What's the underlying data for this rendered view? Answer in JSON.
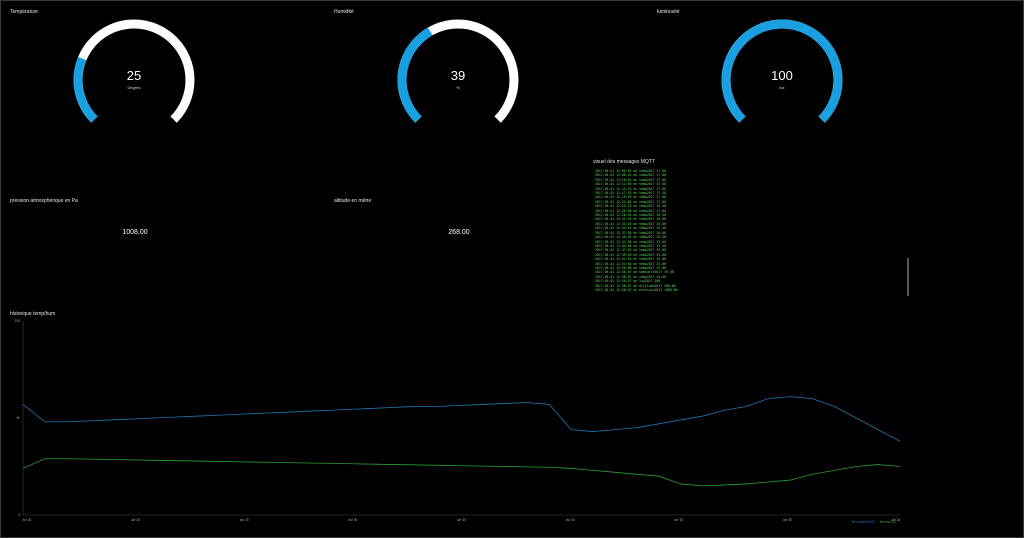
{
  "gauges": [
    {
      "title": "Température",
      "value": "25",
      "unit": "Degres",
      "fraction": 0.25,
      "color": "#1aa0e0"
    },
    {
      "title": "Humidité",
      "value": "39",
      "unit": "%",
      "fraction": 0.39,
      "color": "#1aa0e0"
    },
    {
      "title": "luminosité",
      "value": "100",
      "unit": "lux",
      "fraction": 1.0,
      "color": "#1aa0e0"
    }
  ],
  "pressure": {
    "title": "pression atmosphérique en Pa",
    "value": "1008.00"
  },
  "altitude": {
    "title": "altitude en mètre",
    "value": "268.00"
  },
  "mqtt": {
    "title": "visuel des messages MQTT",
    "messages": [
      "2017-05-01 12:05:53 on temp2017 27.00",
      "2017-05-01 12:08:22 on temp2017 27.00",
      "2017-05-01 12:10:41 on temp2017 27.00",
      "2017-05-01 12:12:55 on temp2017 27.00",
      "2017-05-01 12:15:13 on temp2017 27.00",
      "2017-05-01 12:17:31 on temp2017 27.50",
      "2017-05-01 12:19:49 on temp2017 27.00",
      "2017-05-01 12:22:06 on temp2017 27.00",
      "2017-05-01 12:24:22 on temp2017 26.50",
      "2017-05-01 12:26:38 on temp2017 27.00",
      "2017-05-01 12:28:54 on temp2017 26.50",
      "2017-05-01 12:31:10 on temp2017 26.00",
      "2017-05-01 12:33:26 on temp2017 26.00",
      "2017-05-01 12:35:42 on temp2017 25.50",
      "2017-05-01 12:37:58 on temp2017 26.00",
      "2017-05-01 12:40:14 on temp2017 25.50",
      "2017-05-01 12:42:30 on temp2017 25.00",
      "2017-05-01 12:44:46 on temp2017 25.50",
      "2017-05-01 12:47:02 on temp2017 25.00",
      "2017-05-01 12:49:18 on temp2017 25.00",
      "2017-05-01 12:51:34 on temp2017 25.00",
      "2017-05-01 12:53:50 on temp2017 25.00",
      "2017-05-01 12:56:06 on temp2017 25.00",
      "2017-05-01 12:58:07 on humidite2017 39.00",
      "2017-05-01 12:58:07 on temp2017 25.00",
      "2017-05-01 12:58:07 on lux2017 100",
      "2017-05-01 12:58:07 on altitude2017 268.00",
      "2017-05-01 12:58:07 on pression2017 1008.00"
    ]
  },
  "chart": {
    "title": "historique temp/hum",
    "y_ticks": [
      "100",
      "50",
      "0"
    ],
    "x_ticks": [
      "avr 30",
      "avr 30",
      "avr 30",
      "avr 30",
      "avr 30",
      "avr 30",
      "avr 30",
      "avr 30",
      "avr 30"
    ],
    "series": [
      {
        "name": "humidite2017",
        "color": "#1f77b4"
      },
      {
        "name": "temp2017",
        "color": "#2ca02c"
      }
    ]
  },
  "chart_data": {
    "type": "line",
    "title": "historique temp/hum",
    "ylim": [
      0,
      100
    ],
    "x": [
      0,
      1,
      2,
      3,
      4,
      5,
      6,
      7,
      8,
      9,
      10,
      11,
      12,
      13,
      14,
      15,
      16,
      17,
      18,
      19,
      20,
      21,
      22,
      23,
      24,
      25,
      26,
      27,
      28,
      29,
      30,
      31,
      32,
      33,
      34,
      35,
      36,
      37,
      38,
      39,
      40
    ],
    "series": [
      {
        "name": "humidite2017",
        "values": [
          57,
          48,
          48,
          48.5,
          49,
          49.5,
          50,
          50.5,
          51,
          51.5,
          52,
          52.5,
          53,
          53.5,
          54,
          54.5,
          55,
          55.5,
          56,
          56,
          56.5,
          57,
          57.5,
          58,
          57,
          44,
          43,
          44,
          45,
          47,
          49,
          51,
          54,
          56,
          60,
          61,
          60,
          56,
          50,
          44,
          38
        ]
      },
      {
        "name": "temp2017",
        "values": [
          24,
          29,
          29,
          28.8,
          28.6,
          28.4,
          28.2,
          28,
          27.8,
          27.6,
          27.4,
          27.2,
          27,
          26.8,
          26.6,
          26.4,
          26.2,
          26,
          25.8,
          25.6,
          25.4,
          25.2,
          25,
          24.8,
          24.6,
          24,
          23,
          22,
          21,
          20,
          16,
          15,
          15.5,
          16,
          17,
          18,
          21,
          23,
          25,
          26,
          25
        ]
      }
    ]
  }
}
